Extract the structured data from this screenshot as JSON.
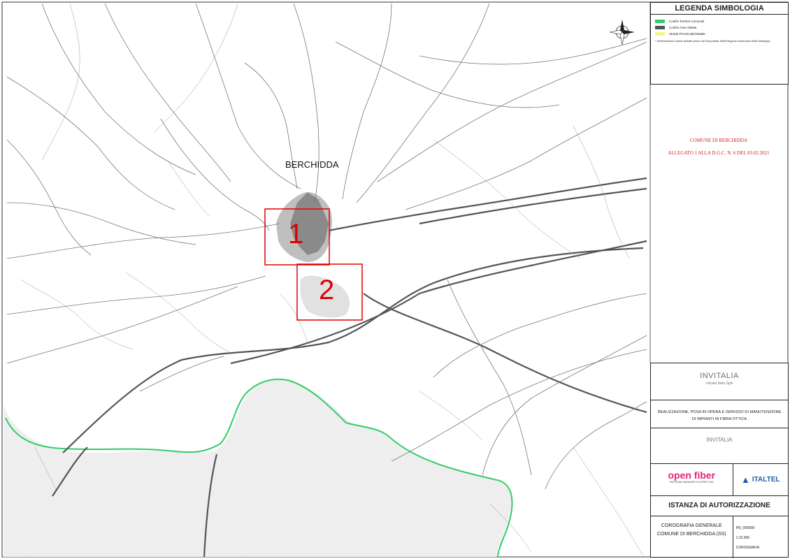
{
  "map": {
    "town_label": "BERCHIDDA",
    "area_numbers": [
      "1",
      "2"
    ]
  },
  "legend": {
    "title": "LEGENDA SIMBOLOGIA",
    "items": [
      {
        "label": "Confini Territori Comunali",
        "color": "#33cc66"
      },
      {
        "label": "Confini Aree Abitate",
        "color": "#555555"
      },
      {
        "label": "Strada Provinciale/Statale",
        "color": "#f4f48c"
      }
    ],
    "note": "* Deliminazione centro abitato preso dal Geoportale della Regione Autonoma della Sardegna"
  },
  "notice": {
    "line1": "COMUNE DI BERCHIDDA",
    "line2": "ALLEGATO 1 ALLA D.G.C. N. 6 DEL 03.02.2021"
  },
  "title_block": {
    "client_logo": "INVITALIA",
    "client_sub": "Infratel Italia SpA",
    "project_line1": "REALIZZAZIONE, POSA IN OPERA E SERVIZIO DI MANUTENZIONE",
    "project_line2": "DI IMPIANTI IN FIBRA OTTICA",
    "small_logo": "INVITALIA",
    "contractor_logo": "open fiber",
    "contractor_sub": "REGIONAL MANAGER CLUSTER C&D",
    "designer_logo": "ITALTEL",
    "document_title": "ISTANZA DI AUTORIZZAZIONE",
    "coro_line1": "COROGRAFIA GENERALE",
    "coro_line2": "COMUNE DI BERCHIDDA (SS)",
    "scale": "1:10.000",
    "code": "PR_090008",
    "type": "COROGRAFIA"
  },
  "colors": {
    "boundary_green": "#33cc66",
    "area_box_red": "#e00000",
    "road_gray": "#555555"
  }
}
